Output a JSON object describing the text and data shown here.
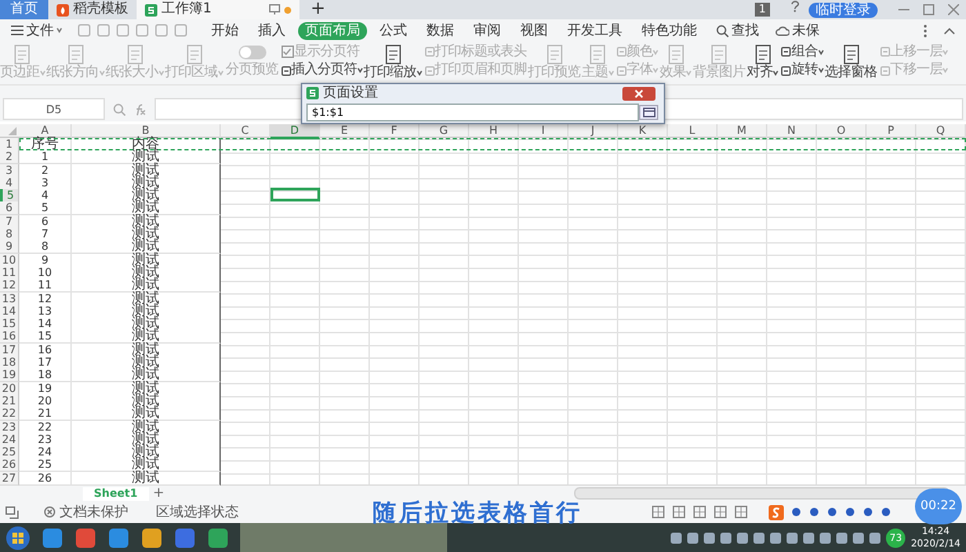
{
  "title_bar": {
    "tabs": [
      {
        "label": "首页",
        "kind": "home",
        "selected": false
      },
      {
        "label": "稻壳模板",
        "kind": "docer",
        "selected": false
      },
      {
        "label": "工作簿1",
        "kind": "sheet",
        "selected": true
      }
    ],
    "new_tab": "+",
    "page_number": "1",
    "login_button": "临时登录"
  },
  "menu_bar": {
    "file_menu": "文件",
    "tabs": [
      {
        "label": "开始",
        "selected": false
      },
      {
        "label": "插入",
        "selected": false
      },
      {
        "label": "页面布局",
        "selected": true
      },
      {
        "label": "公式",
        "selected": false
      },
      {
        "label": "数据",
        "selected": false
      },
      {
        "label": "审阅",
        "selected": false
      },
      {
        "label": "视图",
        "selected": false
      },
      {
        "label": "开发工具",
        "selected": false
      },
      {
        "label": "特色功能",
        "selected": false
      }
    ],
    "search": "查找",
    "save_status": "未保"
  },
  "ribbon": [
    {
      "kind": "large",
      "label": "页边距",
      "dropdown": true,
      "disabled": true
    },
    {
      "kind": "large",
      "label": "纸张方向",
      "dropdown": true,
      "disabled": true
    },
    {
      "kind": "large",
      "label": "纸张大小",
      "dropdown": true,
      "disabled": true
    },
    {
      "kind": "large",
      "label": "打印区域",
      "dropdown": true,
      "disabled": true
    },
    {
      "kind": "toggle",
      "label": "分页预览",
      "on": false,
      "disabled": true
    },
    {
      "kind": "stack",
      "items": [
        {
          "kind": "check",
          "label": "显示分页符",
          "checked": true,
          "dropdown": false,
          "disabled": true
        },
        {
          "kind": "button",
          "label": "插入分页符",
          "dropdown": true,
          "disabled": false
        }
      ]
    },
    {
      "kind": "large",
      "label": "打印缩放",
      "dropdown": true,
      "disabled": false
    },
    {
      "kind": "stack",
      "items": [
        {
          "kind": "button",
          "label": "打印标题或表头",
          "dropdown": false,
          "disabled": true
        },
        {
          "kind": "button",
          "label": "打印页眉和页脚",
          "dropdown": false,
          "disabled": true
        }
      ]
    },
    {
      "kind": "large",
      "label": "打印预览",
      "dropdown": false,
      "disabled": true
    },
    {
      "kind": "large",
      "label": "主题",
      "dropdown": true,
      "disabled": true
    },
    {
      "kind": "stack",
      "items": [
        {
          "kind": "button",
          "label": "颜色",
          "dropdown": true,
          "disabled": true
        },
        {
          "kind": "button",
          "label": "字体",
          "dropdown": true,
          "disabled": true
        }
      ]
    },
    {
      "kind": "large",
      "label": "效果",
      "dropdown": true,
      "disabled": true
    },
    {
      "kind": "large",
      "label": "背景图片",
      "dropdown": false,
      "disabled": true
    },
    {
      "kind": "large",
      "label": "对齐",
      "dropdown": true,
      "disabled": false
    },
    {
      "kind": "stack",
      "items": [
        {
          "kind": "button",
          "label": "组合",
          "dropdown": true,
          "disabled": false
        },
        {
          "kind": "button",
          "label": "旋转",
          "dropdown": true,
          "disabled": false
        }
      ]
    },
    {
      "kind": "large",
      "label": "选择窗格",
      "dropdown": false,
      "disabled": false
    },
    {
      "kind": "stack",
      "items": [
        {
          "kind": "button",
          "label": "上移一层",
          "dropdown": true,
          "disabled": true
        },
        {
          "kind": "button",
          "label": "下移一层",
          "dropdown": true,
          "disabled": true
        }
      ]
    }
  ],
  "formula_bar": {
    "cell_name": "D5"
  },
  "dialog": {
    "title": "页面设置",
    "value": "$1:$1"
  },
  "sheet": {
    "columns": [
      {
        "label": "A",
        "selected": false
      },
      {
        "label": "B",
        "selected": false
      },
      {
        "label": "C",
        "selected": false
      },
      {
        "label": "D",
        "selected": true
      },
      {
        "label": "E",
        "selected": false
      },
      {
        "label": "F",
        "selected": false
      },
      {
        "label": "G",
        "selected": false
      },
      {
        "label": "H",
        "selected": false
      },
      {
        "label": "I",
        "selected": false
      },
      {
        "label": "J",
        "selected": false
      },
      {
        "label": "K",
        "selected": false
      },
      {
        "label": "L",
        "selected": false
      },
      {
        "label": "M",
        "selected": false
      },
      {
        "label": "N",
        "selected": false
      },
      {
        "label": "O",
        "selected": false
      },
      {
        "label": "P",
        "selected": false
      },
      {
        "label": "Q",
        "selected": false
      }
    ],
    "rows": [
      {
        "label": "1",
        "selected": false,
        "range_selected": true,
        "cells": [
          "序号",
          "内容"
        ]
      },
      {
        "label": "2",
        "selected": false,
        "range_selected": false,
        "cells": [
          "1",
          "测试"
        ]
      },
      {
        "label": "3",
        "selected": false,
        "range_selected": false,
        "cells": [
          "2",
          "测试"
        ]
      },
      {
        "label": "4",
        "selected": false,
        "range_selected": false,
        "cells": [
          "3",
          "测试"
        ]
      },
      {
        "label": "5",
        "selected": true,
        "range_selected": false,
        "cells": [
          "4",
          "测试"
        ]
      },
      {
        "label": "6",
        "selected": false,
        "range_selected": false,
        "cells": [
          "5",
          "测试"
        ]
      },
      {
        "label": "7",
        "selected": false,
        "range_selected": false,
        "cells": [
          "6",
          "测试"
        ]
      },
      {
        "label": "8",
        "selected": false,
        "range_selected": false,
        "cells": [
          "7",
          "测试"
        ]
      },
      {
        "label": "9",
        "selected": false,
        "range_selected": false,
        "cells": [
          "8",
          "测试"
        ]
      },
      {
        "label": "10",
        "selected": false,
        "range_selected": false,
        "cells": [
          "9",
          "测试"
        ]
      },
      {
        "label": "11",
        "selected": false,
        "range_selected": false,
        "cells": [
          "10",
          "测试"
        ]
      },
      {
        "label": "12",
        "selected": false,
        "range_selected": false,
        "cells": [
          "11",
          "测试"
        ]
      },
      {
        "label": "13",
        "selected": false,
        "range_selected": false,
        "cells": [
          "12",
          "测试"
        ]
      },
      {
        "label": "14",
        "selected": false,
        "range_selected": false,
        "cells": [
          "13",
          "测试"
        ]
      },
      {
        "label": "15",
        "selected": false,
        "range_selected": false,
        "cells": [
          "14",
          "测试"
        ]
      },
      {
        "label": "16",
        "selected": false,
        "range_selected": false,
        "cells": [
          "15",
          "测试"
        ]
      },
      {
        "label": "17",
        "selected": false,
        "range_selected": false,
        "cells": [
          "16",
          "测试"
        ]
      },
      {
        "label": "18",
        "selected": false,
        "range_selected": false,
        "cells": [
          "17",
          "测试"
        ]
      },
      {
        "label": "19",
        "selected": false,
        "range_selected": false,
        "cells": [
          "18",
          "测试"
        ]
      },
      {
        "label": "20",
        "selected": false,
        "range_selected": false,
        "cells": [
          "19",
          "测试"
        ]
      },
      {
        "label": "21",
        "selected": false,
        "range_selected": false,
        "cells": [
          "20",
          "测试"
        ]
      },
      {
        "label": "22",
        "selected": false,
        "range_selected": false,
        "cells": [
          "21",
          "测试"
        ]
      },
      {
        "label": "23",
        "selected": false,
        "range_selected": false,
        "cells": [
          "22",
          "测试"
        ]
      },
      {
        "label": "24",
        "selected": false,
        "range_selected": false,
        "cells": [
          "23",
          "测试"
        ]
      },
      {
        "label": "25",
        "selected": false,
        "range_selected": false,
        "cells": [
          "24",
          "测试"
        ]
      },
      {
        "label": "26",
        "selected": false,
        "range_selected": false,
        "cells": [
          "25",
          "测试"
        ]
      },
      {
        "label": "27",
        "selected": false,
        "range_selected": false,
        "cells": [
          "26",
          "测试"
        ]
      }
    ]
  },
  "sheet_tabs": [
    {
      "label": "Sheet1",
      "selected": true
    }
  ],
  "add_sheet": "+",
  "status_bar": {
    "protection": "文档未保护",
    "mode": "区域选择状态"
  },
  "caption": "随后拉选表格首行",
  "video_time": "00:22",
  "taskbar": {
    "tray_badge": "73",
    "time": "14:24",
    "date": "2020/2/14"
  }
}
